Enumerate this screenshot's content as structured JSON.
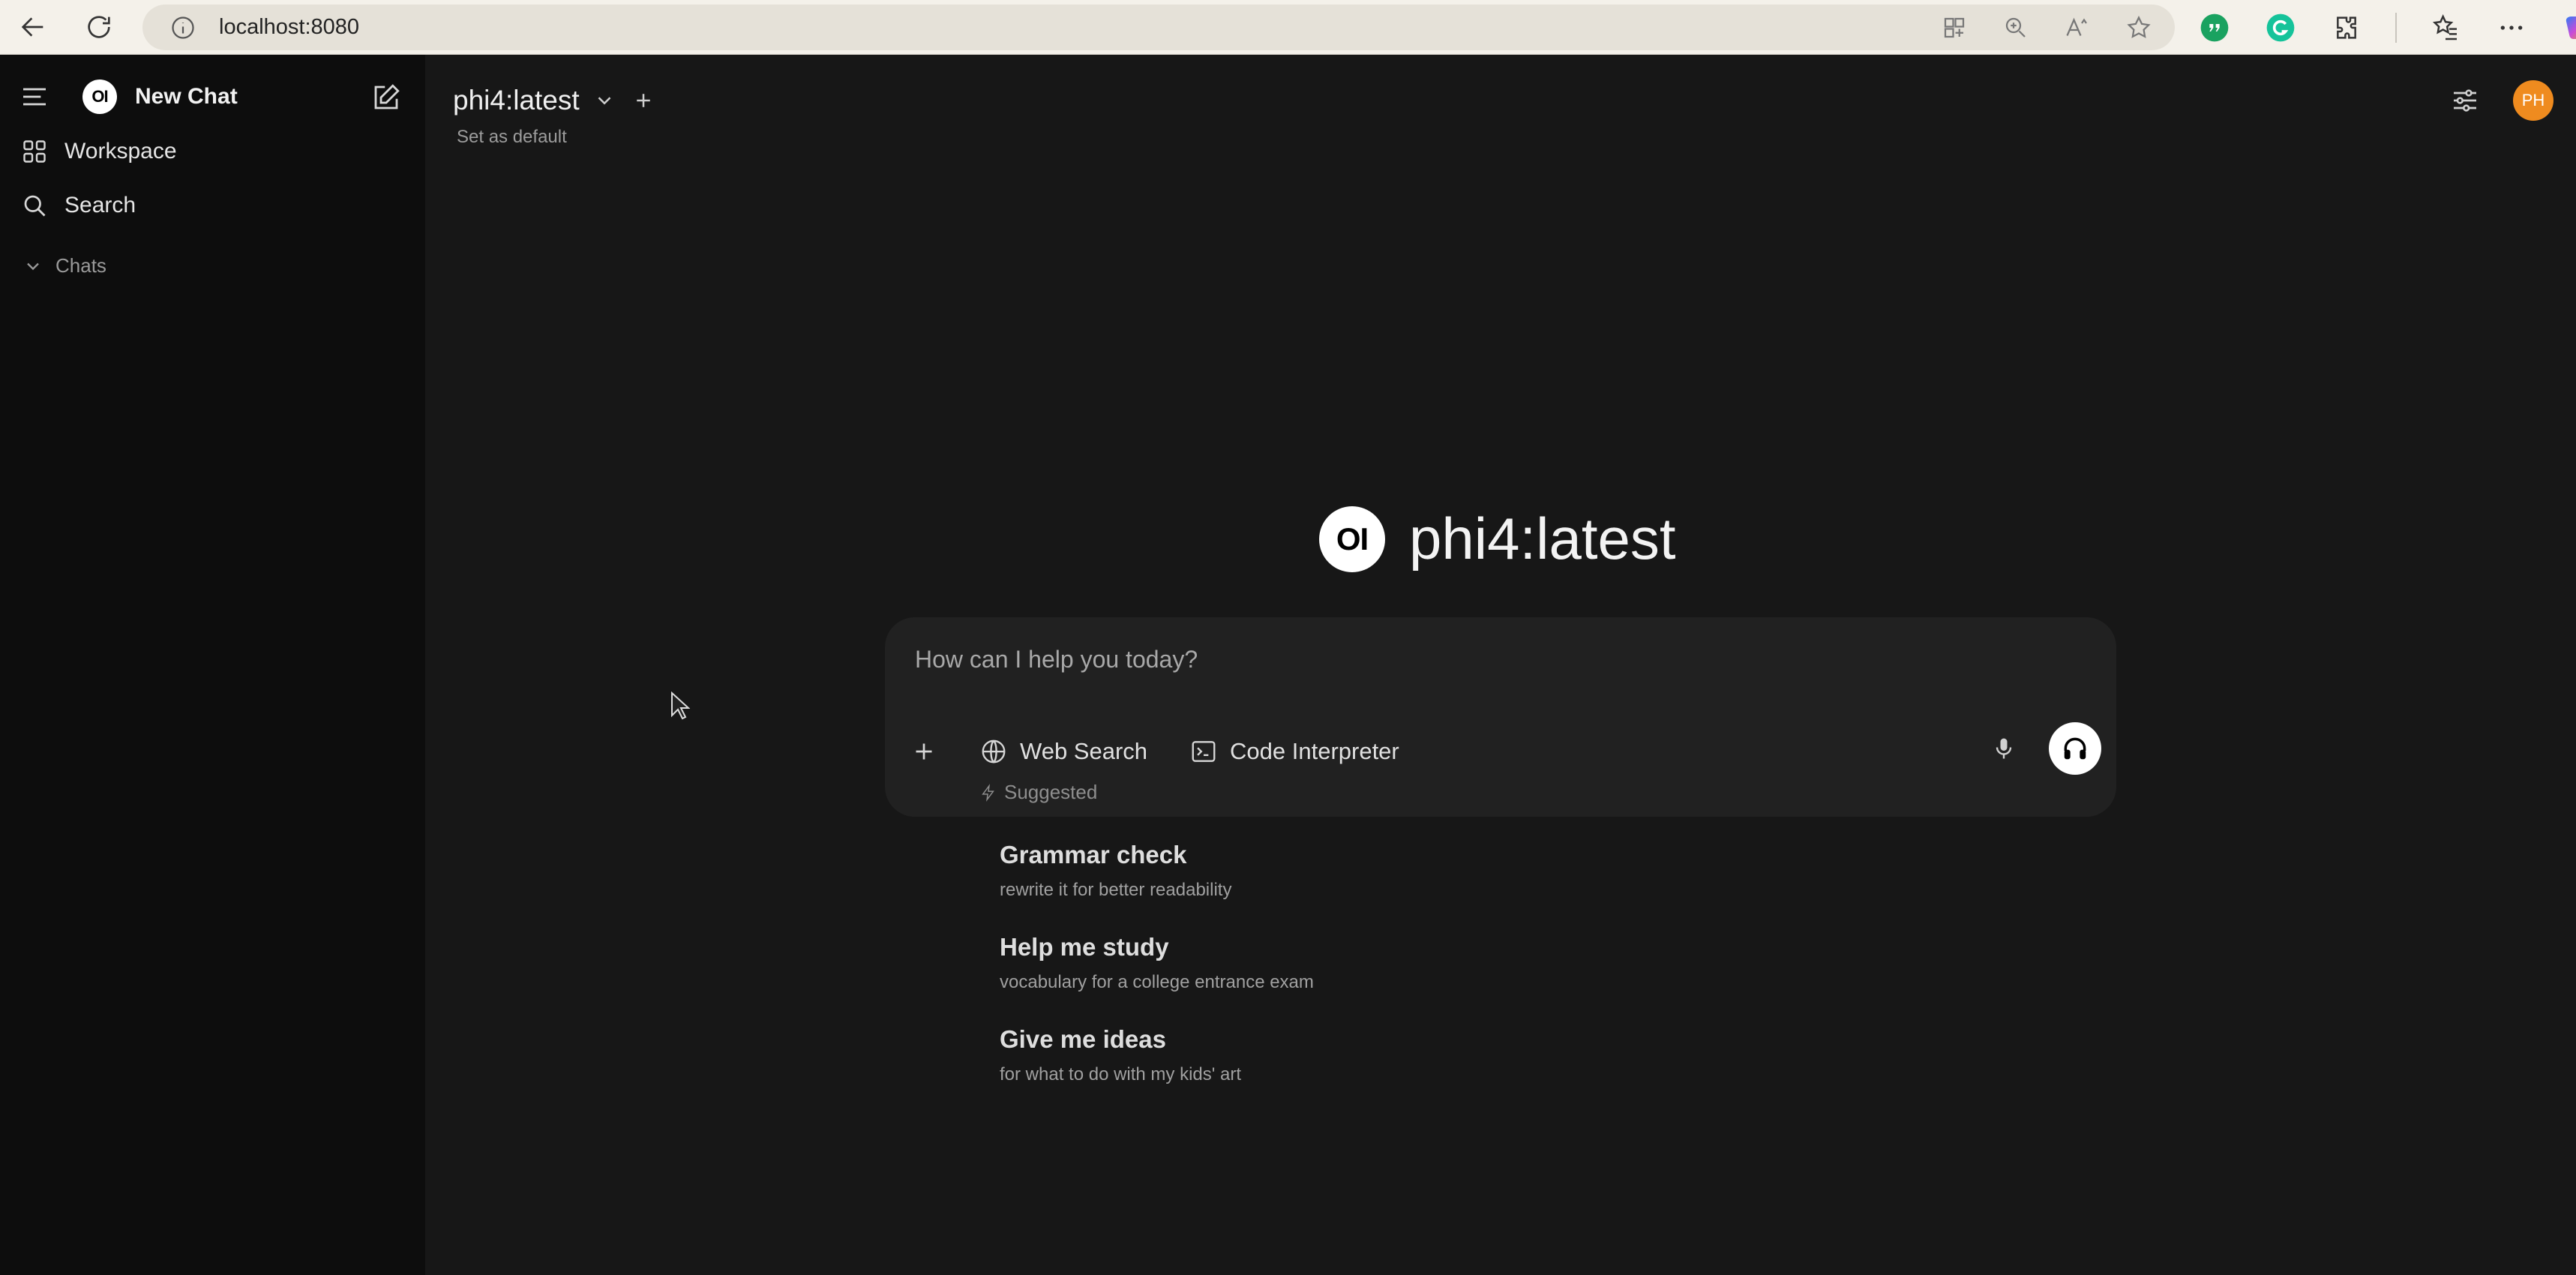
{
  "browser": {
    "url": "localhost:8080"
  },
  "sidebar": {
    "new_chat_label": "New Chat",
    "logo_text": "OI",
    "workspace_label": "Workspace",
    "search_label": "Search",
    "chats_label": "Chats"
  },
  "header": {
    "model_name": "phi4:latest",
    "set_default_label": "Set as default",
    "avatar_initials": "PH"
  },
  "hero": {
    "logo_text": "OI",
    "title": "phi4:latest"
  },
  "composer": {
    "placeholder": "How can I help you today?",
    "web_search_label": "Web Search",
    "code_interpreter_label": "Code Interpreter"
  },
  "suggested": {
    "heading": "Suggested",
    "items": [
      {
        "title": "Grammar check",
        "subtitle": "rewrite it for better readability"
      },
      {
        "title": "Help me study",
        "subtitle": "vocabulary for a college entrance exam"
      },
      {
        "title": "Give me ideas",
        "subtitle": "for what to do with my kids' art"
      }
    ]
  },
  "colors": {
    "sidebar_bg": "#0d0d0d",
    "main_bg": "#171717",
    "composer_bg": "#212121",
    "avatar": "#ef8b1f",
    "browser_chrome": "#f4f1ea"
  }
}
